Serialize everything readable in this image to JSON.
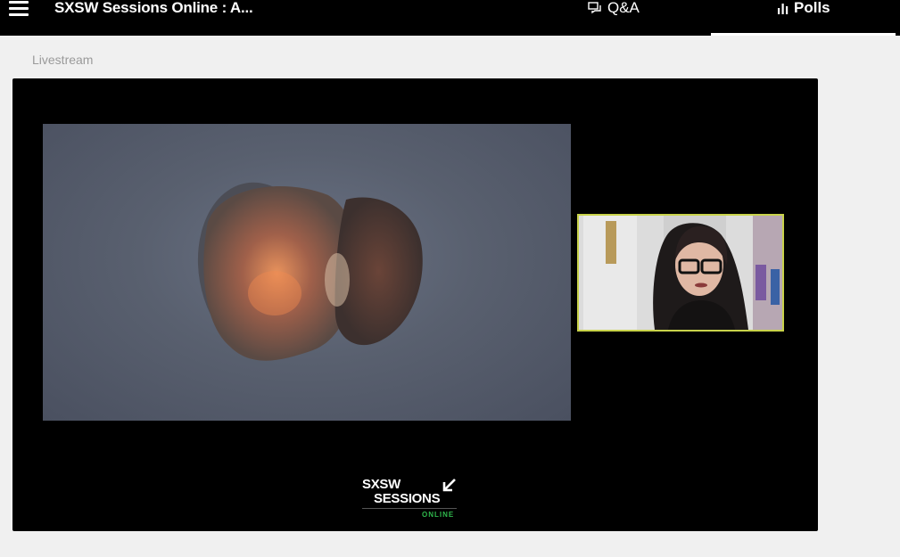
{
  "header": {
    "title": "SXSW Sessions Online : A...",
    "tabs": [
      {
        "label": "Q&A",
        "icon": "chat-bubbles-icon",
        "active": false
      },
      {
        "label": "Polls",
        "icon": "bar-chart-icon",
        "active": true
      }
    ]
  },
  "main": {
    "section_label": "Livestream",
    "player": {
      "logo": {
        "line1": "SXSW",
        "line2": "SESSIONS",
        "line3": "ONLINE",
        "icon": "arrow-down-left-icon"
      }
    }
  },
  "colors": {
    "topbar_bg": "#000000",
    "page_bg": "#f0f0f0",
    "pip_border": "#c8d24a",
    "logo_accent": "#2fb84c"
  }
}
